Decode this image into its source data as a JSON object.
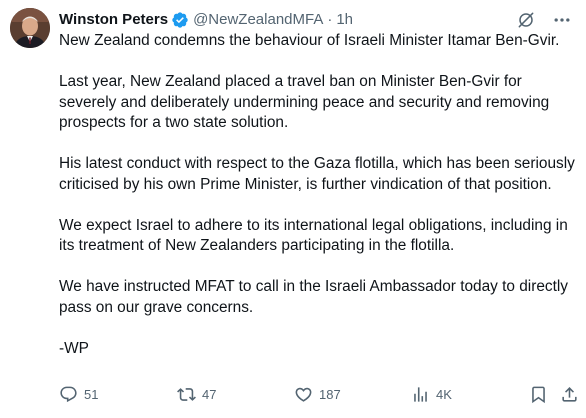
{
  "author": {
    "name": "Winston Peters",
    "handle": "@NewZealandMFA",
    "time": "1h"
  },
  "icons": {
    "verified": "verified-badge-icon",
    "grok": "grok-icon",
    "more": "more-options-icon",
    "reply": "reply-icon",
    "retweet": "retweet-icon",
    "like": "heart-icon",
    "views": "views-chart-icon",
    "bookmark": "bookmark-icon",
    "share": "share-icon"
  },
  "colors": {
    "verified": "#1d9bf0",
    "text": "#0f1419",
    "muted": "#536471"
  },
  "tweet": {
    "paragraphs": [
      "New Zealand condemns the behaviour of Israeli Minister Itamar Ben-Gvir.",
      "Last year, New Zealand placed a travel ban on Minister Ben-Gvir for severely and deliberately undermining peace and security and removing prospects for a two state solution.",
      "His latest conduct with respect to the Gaza flotilla, which has been seriously criticised by his own Prime Minister, is further vindication of that position.",
      "We expect Israel to adhere to its international legal obligations, including in its treatment of New Zealanders participating in the flotilla.",
      "We have instructed MFAT to call in the Israeli Ambassador today to directly pass on our grave concerns.",
      "-WP"
    ]
  },
  "stats": {
    "replies": "51",
    "retweets": "47",
    "likes": "187",
    "views": "4K"
  }
}
